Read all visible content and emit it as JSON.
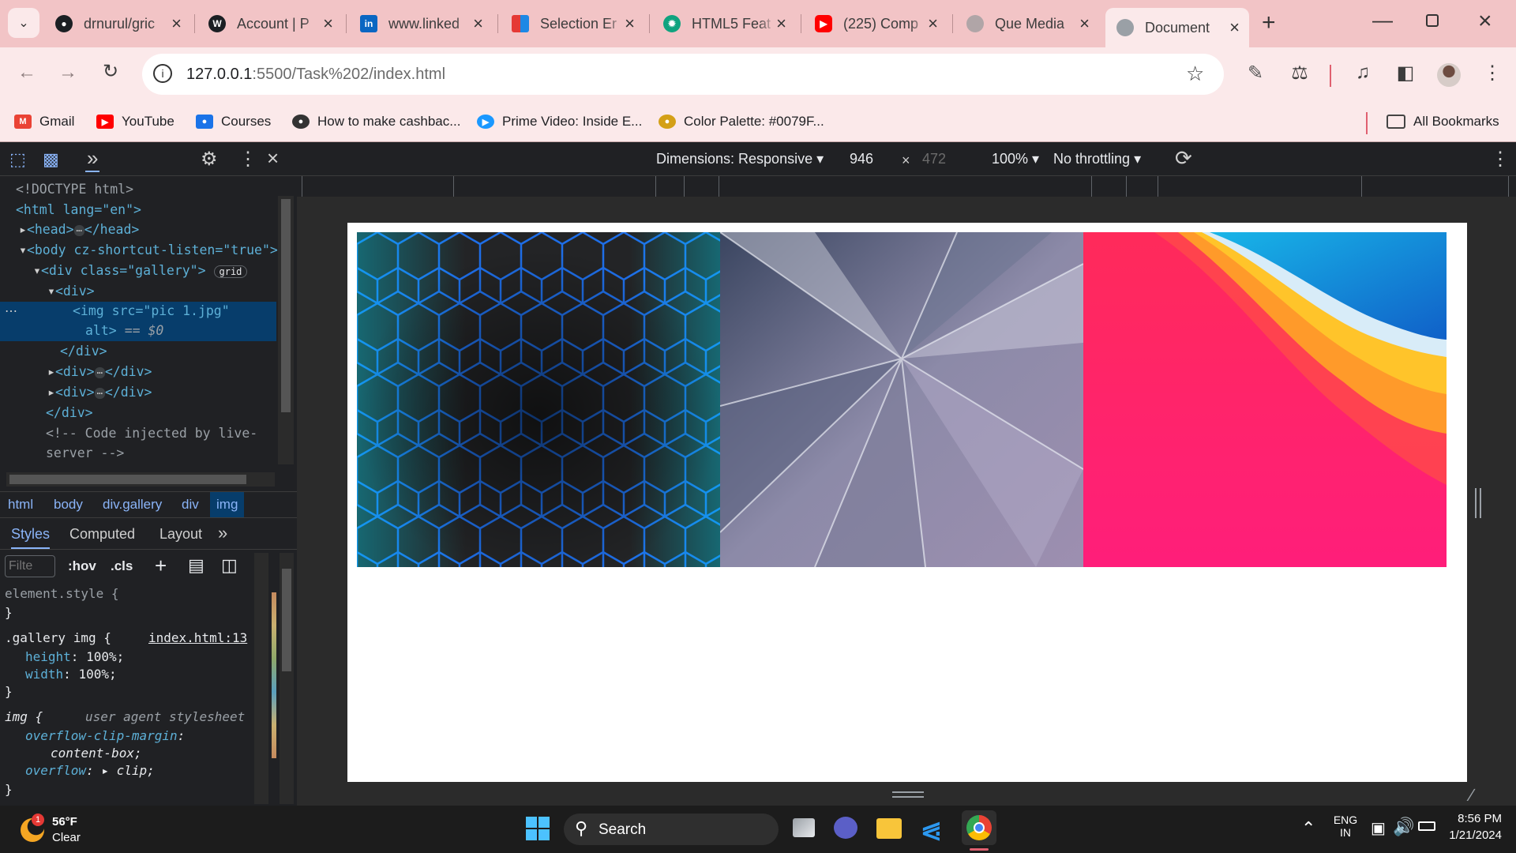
{
  "tabs": [
    {
      "title": "drnurul/gric",
      "icon": "github-icon",
      "color": "#1b1f23"
    },
    {
      "title": "Account | P",
      "icon": "wordpress-icon",
      "color": "#1b1f23"
    },
    {
      "title": "www.linked",
      "icon": "linkedin-icon",
      "color": "#0a66c2"
    },
    {
      "title": "Selection Er",
      "icon": "selection-icon",
      "color": "#e53935"
    },
    {
      "title": "HTML5 Feat",
      "icon": "chatgpt-icon",
      "color": "#10a37f"
    },
    {
      "title": "(225) Comp",
      "icon": "youtube-icon",
      "color": "#ff0000"
    },
    {
      "title": "Que Media",
      "icon": "globe-icon",
      "color": "#9aa0a6"
    },
    {
      "title": "Document",
      "icon": "globe-icon",
      "color": "#9aa0a6"
    }
  ],
  "address": {
    "host": "127.0.0.1",
    "path": ":5500/Task%202/index.html"
  },
  "bookmarks": [
    {
      "label": "Gmail",
      "icon": "gmail-icon",
      "color": "#ea4335"
    },
    {
      "label": "YouTube",
      "icon": "youtube-icon",
      "color": "#ff0000"
    },
    {
      "label": "Courses",
      "icon": "courses-icon",
      "color": "#1a73e8"
    },
    {
      "label": "How to make cashbac...",
      "icon": "cashback-icon",
      "color": "#333333"
    },
    {
      "label": "Prime Video: Inside E...",
      "icon": "prime-video-icon",
      "color": "#1a98ff"
    },
    {
      "label": "Color Palette: #0079F...",
      "icon": "palette-icon",
      "color": "#d4a017"
    }
  ],
  "all_bookmarks": "All Bookmarks",
  "dom_tree": {
    "doctype": "<!DOCTYPE html>",
    "html_open": "<html lang=\"en\">",
    "head": "<head>",
    "head_close": "</head>",
    "body": "<body cz-shortcut-listen=\"true\">",
    "gallery": "<div class=\"gallery\">",
    "grid_badge": "grid",
    "div_open": "<div>",
    "img_line1": "<img src=\"pic 1.jpg\"",
    "img_line2": "alt>",
    "img_eq": "== $0",
    "div_close": "</div>",
    "div_collapsed": "<div>",
    "div_collapsed_close": "</div>",
    "comment1": "<!-- Code injected by live-",
    "comment2": "server -->"
  },
  "breadcrumbs": [
    "html",
    "body",
    "div.gallery",
    "div",
    "img"
  ],
  "style_tabs": [
    "Styles",
    "Computed",
    "Layout"
  ],
  "filter_placeholder": "Filte",
  "hov": ":hov",
  "cls": ".cls",
  "styles": {
    "element_style": "element.style {",
    "close": "}",
    "rule_selector": ".gallery img {",
    "rule_source": "index.html:13",
    "prop1": "height",
    "val1": "100%;",
    "prop2": "width",
    "val2": "100%;",
    "ua_selector": "img {",
    "ua_source": "user agent stylesheet",
    "ua_prop1": "overflow-clip-margin",
    "ua_val1": "content-box;",
    "ua_prop2": "overflow",
    "ua_val2": "clip;"
  },
  "device_bar": {
    "dimensions": "Dimensions: Responsive",
    "width": "946",
    "times": "×",
    "height": "472",
    "zoom": "100%",
    "throttling": "No throttling"
  },
  "gallery_images": [
    {
      "name": "pic 1.jpg",
      "desc": "hexagon-pattern"
    },
    {
      "name": "pic 2.jpg",
      "desc": "glass-shards"
    },
    {
      "name": "pic 3.jpg",
      "desc": "colorful-waves"
    }
  ],
  "taskbar": {
    "weather_temp": "56°F",
    "weather_desc": "Clear",
    "weather_badge": "1",
    "search": "Search",
    "lang1": "ENG",
    "lang2": "IN",
    "time": "8:56 PM",
    "date": "1/21/2024"
  }
}
